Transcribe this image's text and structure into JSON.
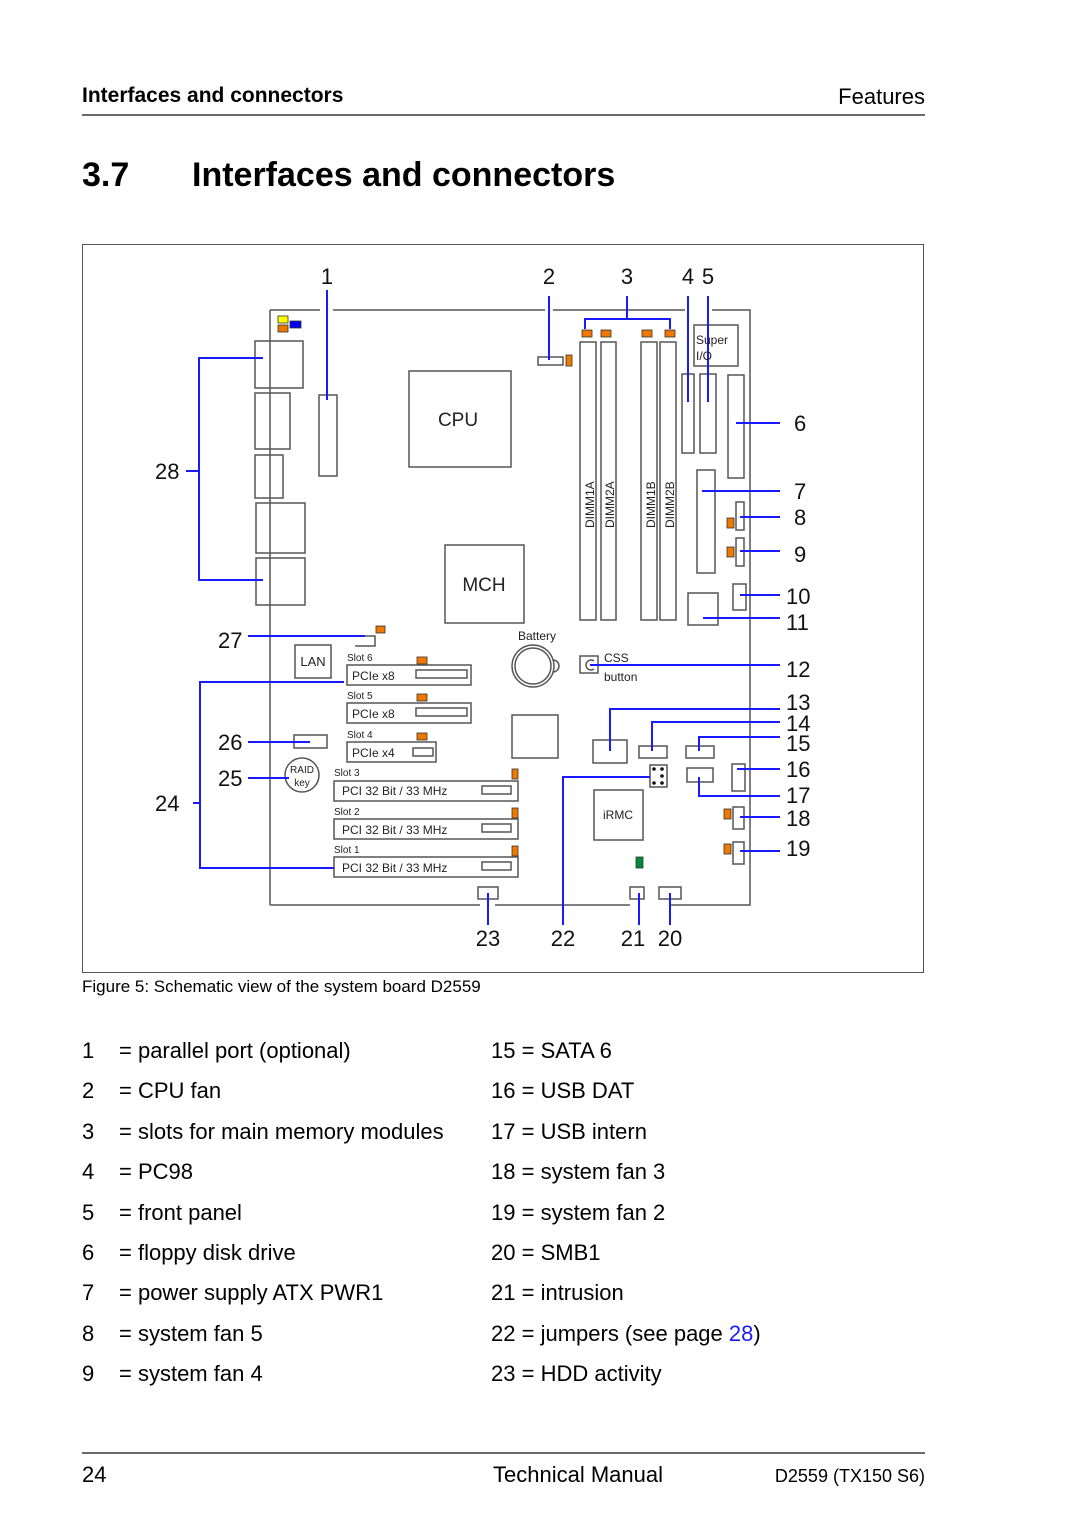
{
  "header": {
    "section_name": "Interfaces and connectors",
    "chapter_name": "Features"
  },
  "section": {
    "number": "3.7",
    "title": "Interfaces and connectors"
  },
  "figure": {
    "caption": "Figure 5: Schematic view of the system board D2559",
    "board_labels": {
      "cpu": "CPU",
      "mch": "MCH",
      "super_io_line1": "Super",
      "super_io_line2": "I/O",
      "dimm1a": "DIMM1A",
      "dimm2a": "DIMM2A",
      "dimm1b": "DIMM1B",
      "dimm2b": "DIMM2B",
      "battery": "Battery",
      "css_line1": "CSS",
      "css_line2": "button",
      "lan": "LAN",
      "raid_line1": "RAID",
      "raid_line2": "key",
      "irmc": "iRMC"
    },
    "slots": [
      {
        "name": "Slot 6",
        "type": "PCIe x8"
      },
      {
        "name": "Slot 5",
        "type": "PCIe x8"
      },
      {
        "name": "Slot 4",
        "type": "PCIe x4"
      },
      {
        "name": "Slot 3",
        "type": "PCI 32 Bit / 33 MHz"
      },
      {
        "name": "Slot 2",
        "type": "PCI 32 Bit / 33 MHz"
      },
      {
        "name": "Slot 1",
        "type": "PCI 32 Bit / 33 MHz"
      }
    ],
    "callouts": [
      "1",
      "2",
      "3",
      "4",
      "5",
      "6",
      "7",
      "8",
      "9",
      "10",
      "11",
      "12",
      "13",
      "14",
      "15",
      "16",
      "17",
      "18",
      "19",
      "20",
      "21",
      "22",
      "23",
      "24",
      "25",
      "26",
      "27",
      "28"
    ],
    "colors": {
      "leader": "#1a1aff",
      "outline": "#555555",
      "led_orange": "#f07800",
      "led_yellow": "#ffff00",
      "led_blue": "#0000ee",
      "led_green": "#008a3a"
    }
  },
  "legend": {
    "left": [
      {
        "num": "1",
        "text": "= parallel port (optional)"
      },
      {
        "num": "2",
        "text": "= CPU fan"
      },
      {
        "num": "3",
        "text": "= slots for main memory modules"
      },
      {
        "num": "4",
        "text": "= PC98"
      },
      {
        "num": "5",
        "text": "= front panel"
      },
      {
        "num": "6",
        "text": "= floppy disk drive"
      },
      {
        "num": "7",
        "text": "= power supply ATX PWR1"
      },
      {
        "num": "8",
        "text": "= system fan 5"
      },
      {
        "num": "9",
        "text": "= system fan 4"
      }
    ],
    "right": [
      {
        "num": "15",
        "text": "= SATA 6"
      },
      {
        "num": "16",
        "text": "= USB DAT"
      },
      {
        "num": "17",
        "text": "= USB intern"
      },
      {
        "num": "18",
        "text": "= system fan 3"
      },
      {
        "num": "19",
        "text": "= system fan 2"
      },
      {
        "num": "20",
        "text": "= SMB1"
      },
      {
        "num": "21",
        "text": "= intrusion"
      },
      {
        "num": "22",
        "text": "= jumpers (see page ",
        "link": "28",
        "after": ")"
      },
      {
        "num": "23",
        "text": "= HDD activity"
      }
    ]
  },
  "footer": {
    "page_number": "24",
    "doc_title": "Technical Manual",
    "model": "D2559 (TX150 S6)"
  }
}
